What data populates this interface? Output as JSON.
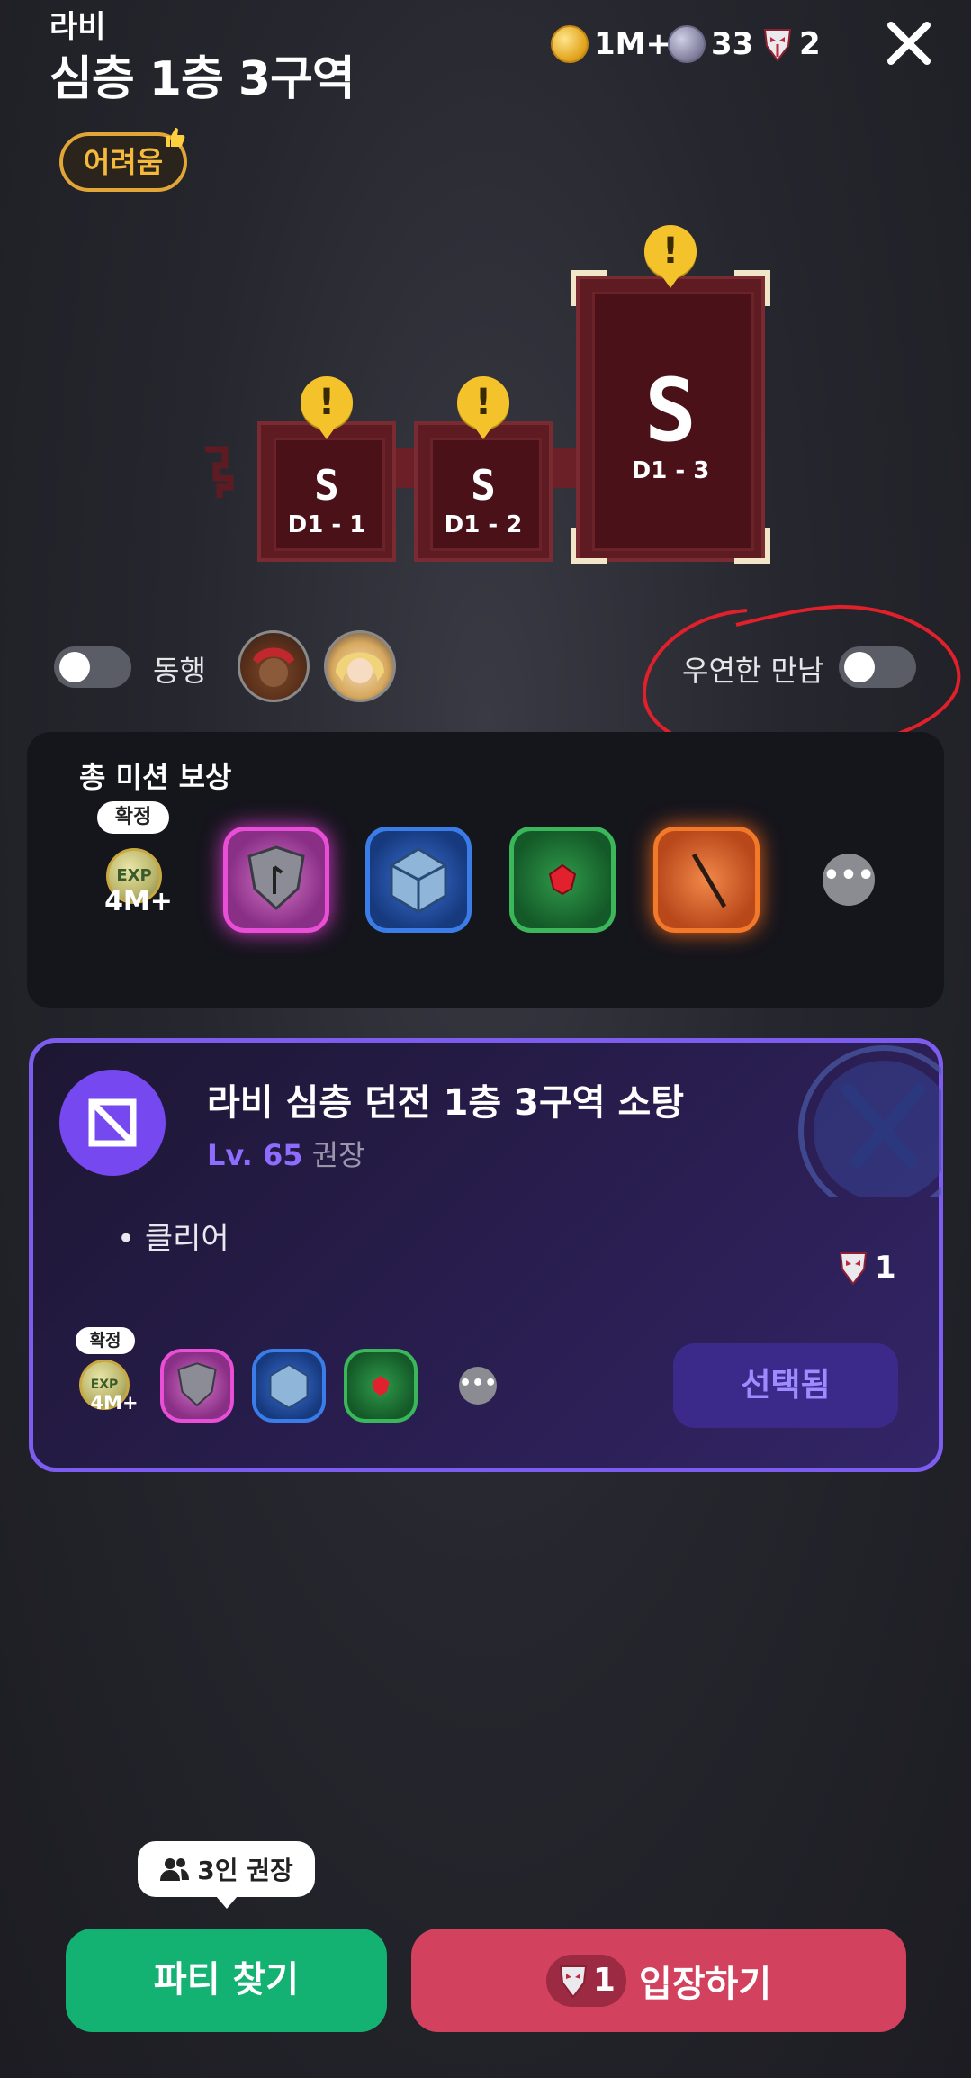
{
  "header": {
    "subtitle": "라비",
    "title": "심층 1층 3구역",
    "difficulty": "어려움",
    "currency": [
      {
        "icon": "gold-coin-icon",
        "value": "1M+"
      },
      {
        "icon": "silver-coin-icon",
        "value": "33"
      },
      {
        "icon": "mask-ticket-icon",
        "value": "2"
      }
    ]
  },
  "map": {
    "rooms": [
      {
        "grade": "S",
        "label": "D1 - 1"
      },
      {
        "grade": "S",
        "label": "D1 - 2"
      },
      {
        "grade": "S",
        "label": "D1 - 3"
      }
    ]
  },
  "options": {
    "companion_label": "동행",
    "chance_meeting_label": "우연한 만남"
  },
  "rewards": {
    "title": "총 미션 보상",
    "confirmed_badge": "확정",
    "exp_value": "4M+",
    "exp_text": "EXP"
  },
  "mission": {
    "title": "라비 심층 던전 1층 3구역 소탕",
    "level_prefix": "Lv. 65",
    "level_suffix": "권장",
    "objective": "클리어",
    "cost": "1",
    "confirmed_badge": "확정",
    "exp_value": "4M+",
    "selected_label": "선택됨"
  },
  "bottom": {
    "tip": "3인 권장",
    "party_button": "파티 찾기",
    "enter_cost": "1",
    "enter_button": "입장하기"
  }
}
